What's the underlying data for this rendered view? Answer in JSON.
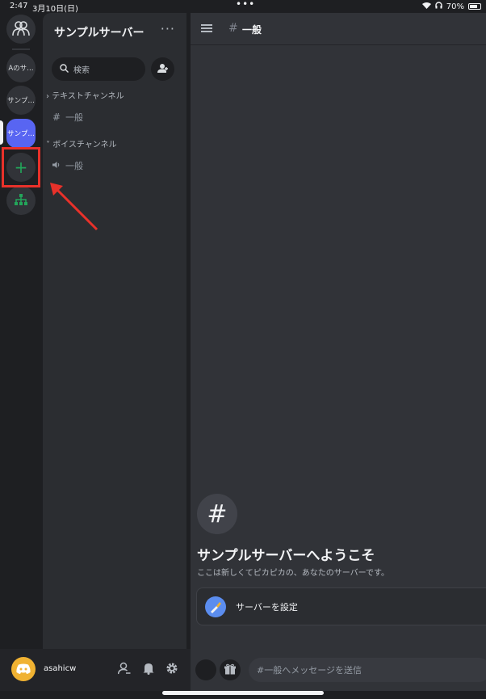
{
  "status": {
    "time": "2:47",
    "date": "3月10日(日)",
    "dots": "•••",
    "battery": "70%"
  },
  "rail": {
    "servers": [
      {
        "label": "Aのサ…"
      },
      {
        "label": "サンプ…"
      },
      {
        "label": "サンプ…"
      }
    ],
    "add_icon": "+"
  },
  "channels": {
    "server_name": "サンプルサーバー",
    "more": "···",
    "search_placeholder": "検索",
    "categories": [
      {
        "label": "テキストチャンネル",
        "channels": [
          {
            "label": "一般"
          }
        ]
      },
      {
        "label": "ボイスチャンネル",
        "channels": [
          {
            "label": "一般"
          }
        ]
      }
    ]
  },
  "header": {
    "hash": "#",
    "channel": "一般"
  },
  "welcome": {
    "icon": "#",
    "title": "サンプルサーバーへようこそ",
    "subtitle": "ここは新しくてピカピカの、あなたのサーバーです。",
    "setup_label": "サーバーを設定"
  },
  "user": {
    "name": "asahicw"
  },
  "message": {
    "placeholder": "#一般へメッセージを送信"
  },
  "colors": {
    "accent": "#5865f2",
    "highlight": "#e8312a",
    "arrow": "#e8312a",
    "add": "#23a55a"
  }
}
